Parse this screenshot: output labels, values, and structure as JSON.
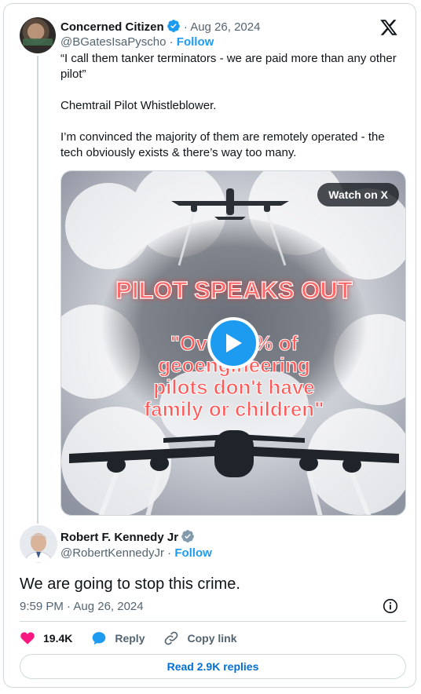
{
  "quoted_tweet": {
    "author_name": "Concerned Citizen",
    "date": "· Aug 26, 2024",
    "handle": "@BGatesIsaPyscho",
    "follow_label": "Follow",
    "text_paragraphs": [
      "“I call them tanker terminators - we are paid more than any other pilot”",
      "Chemtrail Pilot Whistleblower.",
      "I’m convinced the majority of them are remotely operated - the tech obviously exists & there’s way too many."
    ],
    "media": {
      "watch_label": "Watch on X",
      "overlay_title": "PILOT SPEAKS OUT",
      "overlay_quote_lines": [
        "\"Over 90% of",
        "geoengineering",
        "pilots don't have",
        "family or children\""
      ]
    }
  },
  "tweet": {
    "author_name": "Robert F. Kennedy Jr",
    "handle": "@RobertKennedyJr",
    "follow_label": "Follow",
    "text": "We are going to stop this crime.",
    "timestamp": "9:59 PM · Aug 26, 2024"
  },
  "actions": {
    "likes": "19.4K",
    "reply_label": "Reply",
    "copy_link_label": "Copy link",
    "read_replies_label": "Read 2.9K replies"
  },
  "colors": {
    "accent": "#1d9bf0",
    "like": "#f91880",
    "muted_text": "#536471",
    "border": "#cfd9de",
    "overlay_text": "#ff3b3b"
  },
  "icons": [
    "x-logo-icon",
    "verified-badge-icon",
    "play-icon",
    "info-icon",
    "heart-icon",
    "reply-bubble-icon",
    "link-icon"
  ]
}
